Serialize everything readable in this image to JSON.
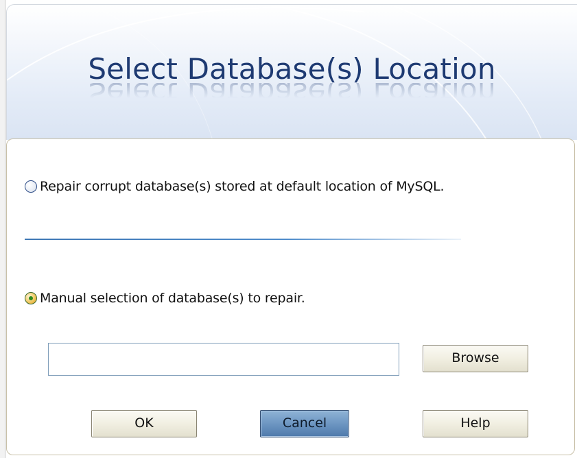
{
  "dialog": {
    "title": "Select Database(s) Location"
  },
  "options": {
    "default_location": {
      "label": "Repair corrupt database(s) stored at default location of MySQL.",
      "selected": false
    },
    "manual_selection": {
      "label": "Manual selection of database(s) to repair.",
      "selected": true
    }
  },
  "path_field": {
    "value": "",
    "placeholder": ""
  },
  "buttons": {
    "browse": "Browse",
    "ok": "OK",
    "cancel": "Cancel",
    "help": "Help"
  },
  "colors": {
    "title_text": "#1e3a72",
    "separator": "#4f8ccb",
    "focused_button": "#6d96c2",
    "selected_radio": "#2d8a1e"
  }
}
